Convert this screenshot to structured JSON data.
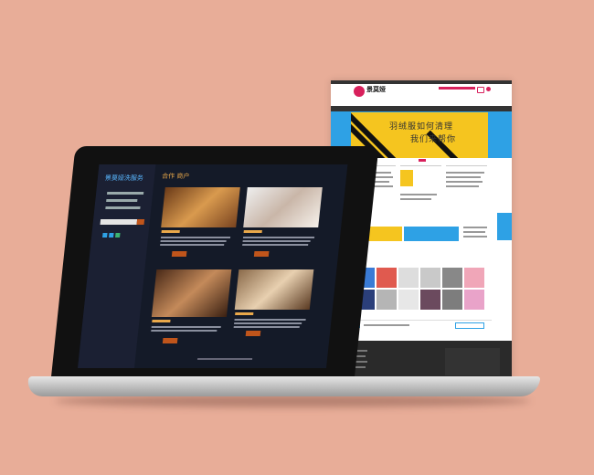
{
  "page": {
    "logo_text": "景莫娅",
    "banner_line1": "羽绒服如何清理",
    "banner_line2": "我们来帮你"
  },
  "laptop": {
    "sidebar_title": "景莫娅洗服务",
    "section_title": "合作 商户"
  },
  "colors": {
    "background": "#e8ad98",
    "banner_yellow": "#f5c51f",
    "banner_blue": "#2ea1e5",
    "accent_pink": "#d8205c",
    "screen_dark": "#141a28",
    "accent_orange": "#e9a84a"
  }
}
